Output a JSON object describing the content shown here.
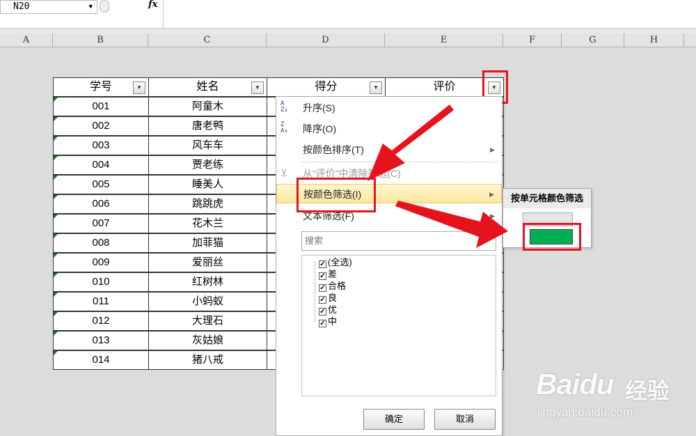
{
  "formula_bar": {
    "name_box": "N20",
    "fx_label": "fx"
  },
  "columns": [
    "A",
    "B",
    "C",
    "D",
    "E",
    "F",
    "G",
    "H"
  ],
  "table": {
    "headers": [
      "学号",
      "姓名",
      "得分",
      "评价"
    ],
    "rows": [
      {
        "id": "001",
        "name": "阿童木"
      },
      {
        "id": "002",
        "name": "唐老鸭"
      },
      {
        "id": "003",
        "name": "风车车"
      },
      {
        "id": "004",
        "name": "贾老练"
      },
      {
        "id": "005",
        "name": "睡美人"
      },
      {
        "id": "006",
        "name": "跳跳虎"
      },
      {
        "id": "007",
        "name": "花木兰"
      },
      {
        "id": "008",
        "name": "加菲猫"
      },
      {
        "id": "009",
        "name": "爱丽丝"
      },
      {
        "id": "010",
        "name": "红树林"
      },
      {
        "id": "011",
        "name": "小蚂蚁"
      },
      {
        "id": "012",
        "name": "大理石"
      },
      {
        "id": "013",
        "name": "灰姑娘"
      },
      {
        "id": "014",
        "name": "猪八戒"
      }
    ]
  },
  "filter_menu": {
    "sort_asc": "升序(S)",
    "sort_desc": "降序(O)",
    "sort_by_color": "按颜色排序(T)",
    "clear_filter": "从“评价”中清除筛选(C)",
    "filter_by_color": "按颜色筛选(I)",
    "text_filter": "文本筛选(F)",
    "search_placeholder": "搜索",
    "items": [
      "(全选)",
      "差",
      "合格",
      "良",
      "优",
      "中"
    ],
    "ok": "确定",
    "cancel": "取消"
  },
  "submenu": {
    "title": "按单元格颜色筛选",
    "swatch_color": "#00b050"
  },
  "colors": {
    "highlight": "#e5131c",
    "swatch_green": "#00b050"
  },
  "watermark": {
    "brand": "Baidu",
    "brand_cn": "经验",
    "url": "jingyan.baidu.com"
  }
}
